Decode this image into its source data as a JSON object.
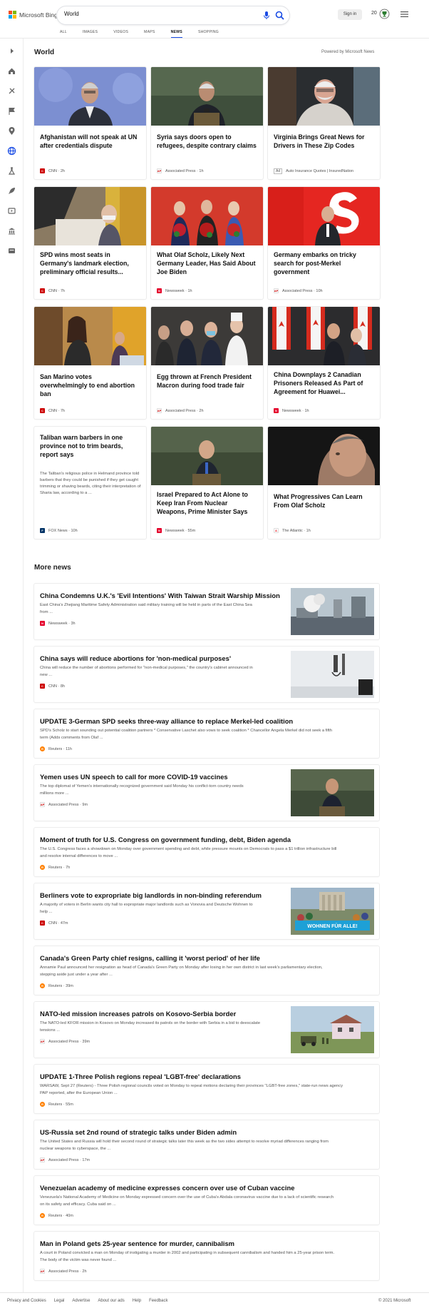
{
  "header": {
    "brand": "Microsoft Bing",
    "search_value": "World",
    "signin_label": "Sign in",
    "rewards_count": "20",
    "brand_colors": [
      "#f25022",
      "#7fba00",
      "#00a4ef",
      "#ffb900"
    ],
    "accent_color": "#174ae4"
  },
  "nav": [
    "ALL",
    "IMAGES",
    "VIDEOS",
    "MAPS",
    "NEWS",
    "SHOPPING"
  ],
  "nav_active": "NEWS",
  "rail_icons": [
    "chevron-right-icon",
    "home-icon",
    "sports-icon",
    "flag-icon",
    "location-pin-icon",
    "globe-icon",
    "science-icon",
    "rocket-icon",
    "entertainment-icon",
    "money-icon",
    "education-icon"
  ],
  "world": {
    "title": "World",
    "powered_by": "Powered by Microsoft News",
    "cards": [
      {
        "title": "Afghanistan will not speak at UN after credentials dispute",
        "source": "CNN",
        "time": "2h"
      },
      {
        "title": "Syria says doors open to refugees, despite contrary claims",
        "source": "Associated Press",
        "time": "1h"
      },
      {
        "title": "Virginia Brings Great News for Drivers in These Zip Codes",
        "ad_label": "Ad",
        "source": "Auto Insurance Quotes | InsuredNation"
      },
      {
        "title": "SPD wins most seats in Germany's landmark election, preliminary official results...",
        "source": "CNN",
        "time": "7h"
      },
      {
        "title": "What Olaf Scholz, Likely Next Germany Leader, Has Said About Joe Biden",
        "source": "Newsweek",
        "time": "1h"
      },
      {
        "title": "Germany embarks on tricky search for post-Merkel government",
        "source": "Associated Press",
        "time": "10h"
      },
      {
        "title": "San Marino votes overwhelmingly to end abortion ban",
        "source": "CNN",
        "time": "7h"
      },
      {
        "title": "Egg thrown at French President Macron during food trade fair",
        "source": "Associated Press",
        "time": "2h"
      },
      {
        "title": "China Downplays 2 Canadian Prisoners Released As Part of Agreement for Huawei...",
        "source": "Newsweek",
        "time": "1h"
      },
      {
        "title": "Taliban warn barbers in one province not to trim beards, report says",
        "summary": "The Taliban's religious police in Helmand province told barbers that they could be punished if they get caught trimming or shaving beards, citing their interpretation of Sharia law, according to a ...",
        "source": "FOX News",
        "time": "10h"
      },
      {
        "title": "Israel Prepared to Act Alone to Keep Iran From Nuclear Weapons, Prime Minister Says",
        "source": "Newsweek",
        "time": "55m"
      },
      {
        "title": "What Progressives Can Learn From Olaf Scholz",
        "source": "The Atlantic",
        "time": "1h"
      }
    ]
  },
  "more_news": {
    "title": "More news",
    "items": [
      {
        "title": "China Condemns U.K.'s 'Evil Intentions' With Taiwan Strait Warship Mission",
        "summary": [
          "East China's Zhejiang Maritime Safety Administration said military training will be held in parts of the East China Sea",
          "from ..."
        ],
        "source": "Newsweek",
        "time": "3h"
      },
      {
        "title": "China says will reduce abortions for 'non-medical purposes'",
        "summary": [
          "China will reduce the number of abortions performed for \"non-medical purposes,\" the country's cabinet announced in",
          "new ..."
        ],
        "source": "CNN",
        "time": "8h"
      },
      {
        "title": "UPDATE 3-German SPD seeks three-way alliance to replace Merkel-led coalition",
        "summary": [
          "SPD's Scholz to start sounding out potential coalition partners * Conservative Laschet also vows to seek coalition * Chancellor Angela Merkel did not seek a fifth",
          "term (Adds comments from Olaf ..."
        ],
        "source": "Reuters",
        "time": "11h"
      },
      {
        "title": "Yemen uses UN speech to call for more COVID-19 vaccines",
        "summary": [
          "The top diplomat of Yemen's internationally recognized government said Monday his conflict-torn country needs",
          "millions more ..."
        ],
        "source": "Associated Press",
        "time": "9m"
      },
      {
        "title": "Moment of truth for U.S. Congress on government funding, debt, Biden agenda",
        "summary": [
          "The U.S. Congress faces a showdown on Monday over government spending and debt, while pressure mounts on Democrats to pass a $1 trillion infrastructure bill",
          "and resolve internal differences to move ..."
        ],
        "source": "Reuters",
        "time": "7h"
      },
      {
        "title": "Berliners vote to expropriate big landlords in non-binding referendum",
        "summary": [
          "A majority of voters in Berlin wants city hall to expropriate major landlords such as Vonovia and Deutsche Wohnen to",
          "help ..."
        ],
        "source": "CNN",
        "time": "47m",
        "thumb_caption": "WOHNEN FÜR ALLE!"
      },
      {
        "title": "Canada's Green Party chief resigns, calling it 'worst period' of her life",
        "summary": [
          "Annamie Paul announced her resignation as head of Canada's Green Party on Monday after losing in her own district in last week's parliamentary election,",
          "stepping aside just under a year after ..."
        ],
        "source": "Reuters",
        "time": "39m"
      },
      {
        "title": "NATO-led mission increases patrols on Kosovo-Serbia border",
        "summary": [
          "The NATO-led KFOR mission in Kosovo on Monday increased its patrols on the border with Serbia in a bid to deescalate",
          "tensions ..."
        ],
        "source": "Associated Press",
        "time": "39m"
      },
      {
        "title": "UPDATE 1-Three Polish regions repeal 'LGBT-free' declarations",
        "summary": [
          "WARSAW, Sept 27 (Reuters) - Three Polish regional councils voted on Monday to repeal motions declaring their provinces \"LGBT-free zones,\" state-run news agency",
          "PAP reported, after the European Union ..."
        ],
        "source": "Reuters",
        "time": "55m"
      },
      {
        "title": "US-Russia set 2nd round of strategic talks under Biden admin",
        "summary": [
          "The United States and Russia will hold their second round of strategic talks later this week as the two sides attempt to resolve myriad differences ranging from",
          "nuclear weapons to cyberspace, the ..."
        ],
        "source": "Associated Press",
        "time": "17m"
      },
      {
        "title": "Venezuelan academy of medicine expresses concern over use of Cuban vaccine",
        "summary": [
          "Venezuela's National Academy of Medicine on Monday expressed concern over the use of Cuba's Abdala coronavirus vaccine due to a lack of scientific research",
          "on its safety and efficacy. Cuba said on ..."
        ],
        "source": "Reuters",
        "time": "40m"
      },
      {
        "title": "Man in Poland gets 25-year sentence for murder, cannibalism",
        "summary": [
          "A court in Poland convicted a man on Monday of instigating a murder in 2002 and participating in subsequent cannibalism and handed him a 25-year prison term.",
          "The body of the victim was never found ..."
        ],
        "source": "Associated Press",
        "time": "2h"
      }
    ]
  },
  "source_colors": {
    "CNN": "#cc0000",
    "Associated Press": "#222222",
    "Newsweek": "#e4002b",
    "Reuters": "#ff8000",
    "FOX News": "#003366",
    "The Atlantic": "#e7131a"
  },
  "footer": {
    "links": [
      "Privacy and Cookies",
      "Legal",
      "Advertise",
      "About our ads",
      "Help",
      "Feedback"
    ],
    "copyright": "© 2021 Microsoft"
  }
}
